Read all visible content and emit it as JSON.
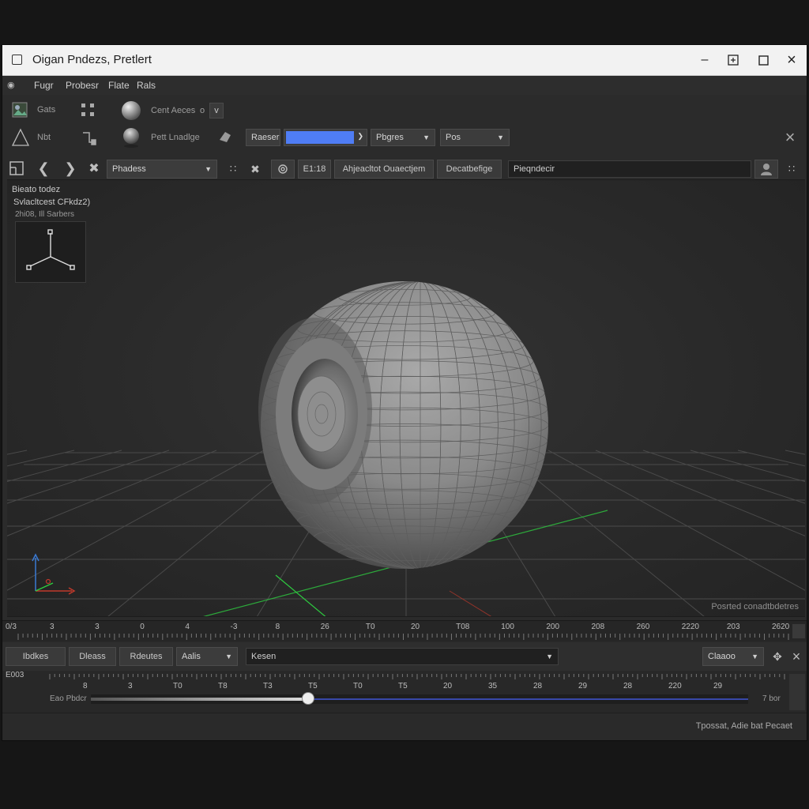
{
  "window": {
    "title": "Oigan Pndezs, Pretlert"
  },
  "menubar": {
    "items": [
      "Fugr",
      "Probesr",
      "Flate",
      "Rals"
    ]
  },
  "left_tools": {
    "row1_label": "Gats",
    "row2_label": "Nbt"
  },
  "tools_row1": {
    "label": "Cent Aeces",
    "small_value": "o",
    "dropdown_caret": "v"
  },
  "tools_row2": {
    "label": "Pett Lnadlge",
    "dd1": "Raeser",
    "color_value": "#4f7df5",
    "dd2": "Pbgres",
    "dd3": "Pos"
  },
  "toolbar3": {
    "dropdown": "Phadess",
    "field_value": "E1:18",
    "btn1": "Ahjeacltot Ouaectjem",
    "btn2": "Decatbefige",
    "search": "Pieqndecir"
  },
  "viewport": {
    "info_line1": "Bieato todez",
    "info_line2": "Svlacltcest CFkdz2)",
    "info_line3": "2hi08, Ill Sarbers",
    "footer_label": "Posrted conadtbdetres",
    "grid_color": "#4a4a4a",
    "x_axis_color": "#c0392b",
    "y_axis_color": "#2ecc40",
    "z_axis_color": "#3a7bd5"
  },
  "timeline": {
    "start_label": "0/3",
    "ticks": [
      "3",
      "3",
      "0",
      "4",
      "-3",
      "8",
      "26",
      "T0",
      "20",
      "T08",
      "100",
      "200",
      "208",
      "260",
      "2220",
      "203",
      "2620"
    ]
  },
  "anim_controls": {
    "btn1": "Ibdkes",
    "btn2": "Dleass",
    "btn3": "Rdeutes",
    "dd1": "Aalis",
    "dd2": "Kesen",
    "dd3": "Claaoo"
  },
  "scrub": {
    "start_label": "E003",
    "ticks": [
      "8",
      "3",
      "T0",
      "T8",
      "T3",
      "T5",
      "T0",
      "T5",
      "20",
      "35",
      "28",
      "29",
      "28",
      "220",
      "29"
    ],
    "row_label": "Eao Pbdcr",
    "end_label": "7 bor",
    "progress": 0.33
  },
  "statusbar": {
    "text": "Tpossat, Adie bat Pecaet"
  }
}
